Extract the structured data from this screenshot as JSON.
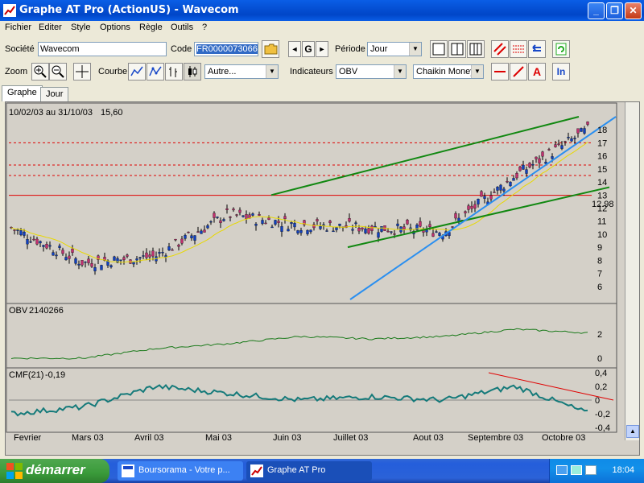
{
  "window": {
    "title": "Graphe AT Pro (ActionUS) - Wavecom"
  },
  "menu": [
    "Fichier",
    "Editer",
    "Style",
    "Options",
    "Règle",
    "Outils",
    "?"
  ],
  "toolbar1": {
    "societe_label": "Société",
    "societe_value": "Wavecom",
    "code_label": "Code",
    "code_value": "FR0000073066",
    "periode_label": "Période",
    "periode_value": "Jour",
    "nav_prev": "◄",
    "nav_go": "G",
    "nav_next": "►"
  },
  "toolbar2": {
    "zoom_label": "Zoom",
    "courbe_label": "Courbe",
    "courbe_value": "Autre...",
    "indicateurs_label": "Indicateurs",
    "indicateur_value": "OBV",
    "indicateur2_value": "Chaikin Money",
    "in_label": "In"
  },
  "tabs": [
    "Graphe",
    "Jour"
  ],
  "chart": {
    "date_range": "10/02/03 au 31/10/03",
    "last_value": "15,60",
    "price_label": "12.98",
    "obv_label": "OBV",
    "obv_value": "2140266",
    "cmf_label": "CMF(21)",
    "cmf_value": "-0,19",
    "months": [
      "Fevrier",
      "Mars 03",
      "Avril 03",
      "Mai 03",
      "Juin 03",
      "Juillet 03",
      "Aout 03",
      "Septembre 03",
      "Octobre 03"
    ],
    "price_ticks": [
      "18",
      "17",
      "16",
      "15",
      "14",
      "13",
      "12",
      "11",
      "10",
      "9",
      "8",
      "7",
      "6"
    ],
    "obv_ticks": [
      "2",
      "0"
    ],
    "cmf_ticks": [
      "0,4",
      "0,2",
      "0",
      "-0,2",
      "-0,4"
    ]
  },
  "chart_data": {
    "type": "line",
    "title": "10/02/03 au 31/10/03",
    "x": [
      "Fevrier",
      "Mars 03",
      "Avril 03",
      "Mai 03",
      "Juin 03",
      "Juillet 03",
      "Aout 03",
      "Septembre 03",
      "Octobre 03"
    ],
    "series": [
      {
        "name": "Wavecom",
        "values": [
          10.5,
          7.8,
          8.3,
          11.5,
          10.7,
          10.5,
          10.2,
          14.5,
          18.0
        ]
      },
      {
        "name": "OBV",
        "values": [
          0,
          0,
          0.8,
          1.2,
          1.8,
          1.6,
          1.8,
          2.4,
          2.1
        ]
      },
      {
        "name": "CMF(21)",
        "values": [
          -0.2,
          -0.1,
          0.2,
          0.1,
          0.0,
          0.05,
          0.0,
          0.2,
          -0.19
        ]
      }
    ],
    "ylim": [
      5,
      19
    ]
  },
  "taskbar": {
    "start_label": "démarrer",
    "tasks": [
      "Boursorama - Votre p...",
      "Graphe AT Pro"
    ],
    "clock": "18:04"
  },
  "colors": {
    "titlebar": "#0a5ee6",
    "chart_bg": "#d4d0c8",
    "green_channel": "#118811",
    "blue_trend": "#2a8ff0",
    "red_line": "#e00000",
    "ma_line": "#e8d800",
    "obv_line": "#1a7a1a",
    "cmf_line": "#157a7a"
  }
}
